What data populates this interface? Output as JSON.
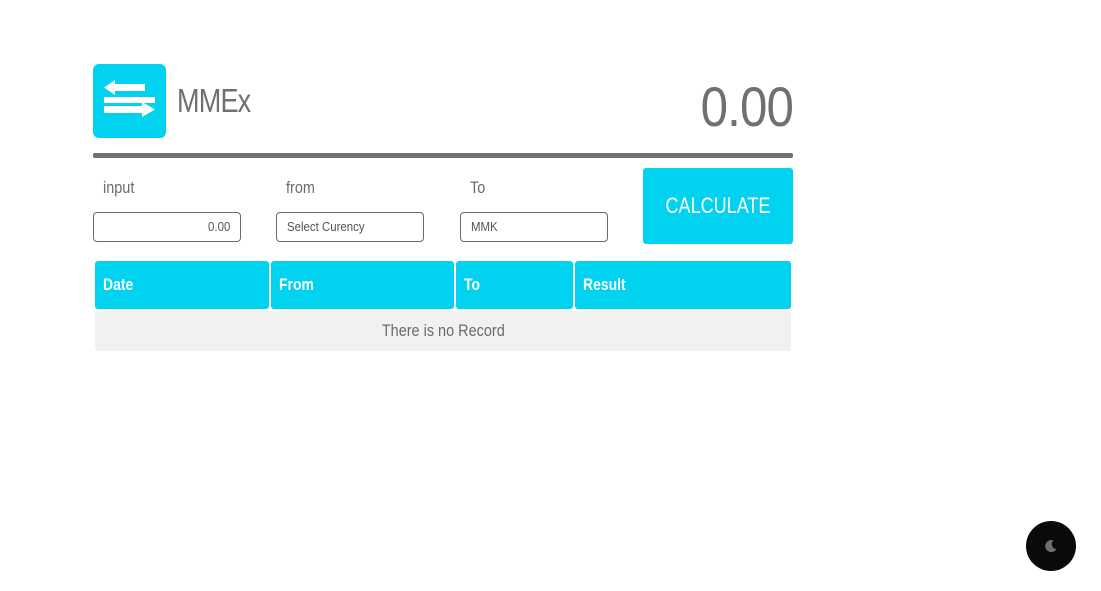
{
  "header": {
    "app_name": "MMEx",
    "result_value": "0.00",
    "logo_icon": "swap-arrows-icon"
  },
  "form": {
    "input_label": "input",
    "input_value": "0.00",
    "from_label": "from",
    "from_value": "Select Curency",
    "to_label": "To",
    "to_value": "MMK",
    "calculate_label": "CALCULATE"
  },
  "table": {
    "columns": [
      "Date",
      "From",
      "To",
      "Result"
    ],
    "empty_message": "There is no Record"
  },
  "theme_toggle": {
    "icon": "moon-icon"
  },
  "colors": {
    "accent": "#00d2f0",
    "text": "#6b6b6b",
    "divider": "#6f6f6f",
    "empty_row_bg": "#f1f1f1",
    "toggle_bg": "#0a0a0a"
  }
}
